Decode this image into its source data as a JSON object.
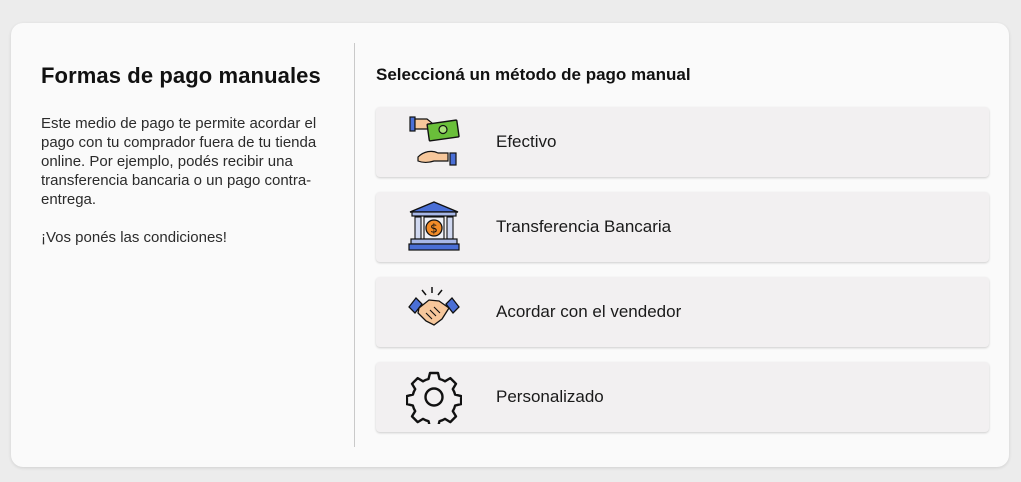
{
  "intro": {
    "title": "Formas de pago manuales",
    "description": "Este medio de pago te permite acordar el pago con tu comprador fuera de tu tienda online. Por ejemplo, podés recibir una transferencia bancaria o un pago contra-entrega.",
    "conditions": "¡Vos ponés las condiciones!"
  },
  "methods": {
    "heading": "Seleccioná un método de pago manual",
    "items": [
      {
        "label": "Efectivo",
        "icon": "cash-hands-icon"
      },
      {
        "label": "Transferencia Bancaria",
        "icon": "bank-icon"
      },
      {
        "label": "Acordar con el vendedor",
        "icon": "handshake-icon"
      },
      {
        "label": "Personalizado",
        "icon": "gear-icon"
      }
    ]
  },
  "colors": {
    "card_background": "#fafafa",
    "option_background": "#f2f0f1",
    "accent_blue": "#4a6fd6",
    "cash_green": "#6abf3a",
    "coin_orange": "#f28c28"
  }
}
